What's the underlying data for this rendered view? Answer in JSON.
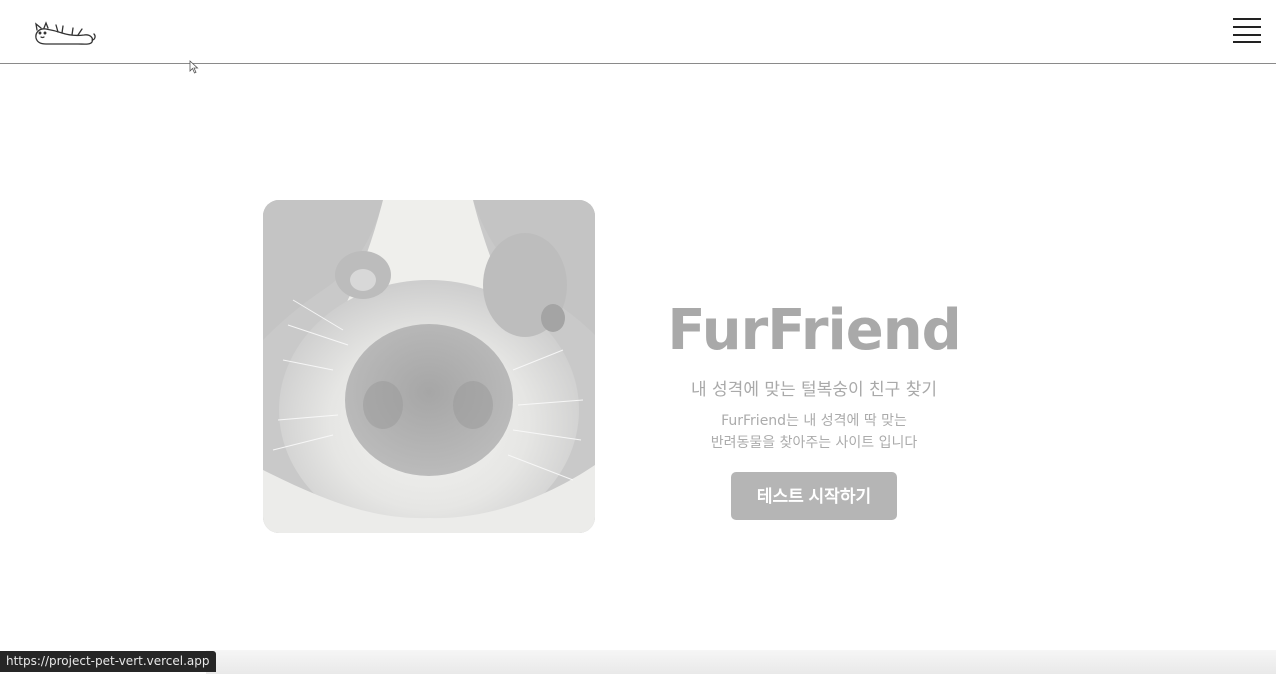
{
  "header": {
    "logo_icon": "cat-lying-logo",
    "menu_icon": "hamburger-menu-icon"
  },
  "hero": {
    "image_subject": "dog-nose-closeup",
    "title": "FurFriend",
    "subtitle": "내 성격에 맞는 털복숭이 친구 찾기",
    "description_line1": "FurFriend는 내 성격에 딱 맞는",
    "description_line2": "반려동물을 찾아주는 사이트 입니다",
    "cta_label": "테스트 시작하기"
  },
  "status_bar": {
    "url": "https://project-pet-vert.vercel.app"
  },
  "colors": {
    "title": "#a9a9a9",
    "button_bg": "#b5b5b5",
    "header_border": "#8a8a8a"
  }
}
